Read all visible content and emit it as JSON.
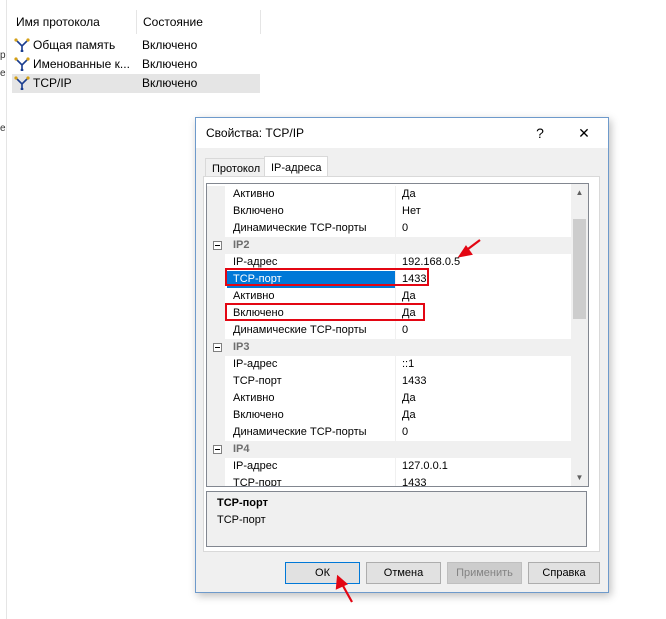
{
  "background": {
    "columns": {
      "name": "Имя протокола",
      "state": "Состояние"
    },
    "rows": [
      {
        "name": "Общая память",
        "state": "Включено"
      },
      {
        "name": "Именованные к...",
        "state": "Включено"
      },
      {
        "name": "TCP/IP",
        "state": "Включено"
      }
    ],
    "edge_marks": [
      "р",
      "е",
      "е"
    ]
  },
  "dialog": {
    "title": "Свойства: TCP/IP",
    "help_glyph": "?",
    "close_glyph": "✕",
    "tabs": [
      "Протокол",
      "IP-адреса"
    ],
    "properties": [
      {
        "label": "Активно",
        "value": "Да"
      },
      {
        "label": "Включено",
        "value": "Нет"
      },
      {
        "label": "Динамические TCP-порты",
        "value": "0"
      },
      {
        "category": "IP2"
      },
      {
        "label": "IP-адрес",
        "value": "192.168.0.5"
      },
      {
        "label": "TCP-порт",
        "value": "1433"
      },
      {
        "label": "Активно",
        "value": "Да"
      },
      {
        "label": "Включено",
        "value": "Да"
      },
      {
        "label": "Динамические TCP-порты",
        "value": "0"
      },
      {
        "category": "IP3"
      },
      {
        "label": "IP-адрес",
        "value": "::1"
      },
      {
        "label": "TCP-порт",
        "value": "1433"
      },
      {
        "label": "Активно",
        "value": "Да"
      },
      {
        "label": "Включено",
        "value": "Да"
      },
      {
        "label": "Динамические TCP-порты",
        "value": "0"
      },
      {
        "category": "IP4"
      },
      {
        "label": "IP-адрес",
        "value": "127.0.0.1"
      },
      {
        "label": "TCP-порт",
        "value": "1433"
      }
    ],
    "description": {
      "title": "TCP-порт",
      "text": "TCP-порт"
    },
    "buttons": {
      "ok": "ОК",
      "cancel": "Отмена",
      "apply": "Применить",
      "help": "Справка"
    }
  },
  "colors": {
    "annotation": "#e30613",
    "selection": "#0078d7"
  }
}
